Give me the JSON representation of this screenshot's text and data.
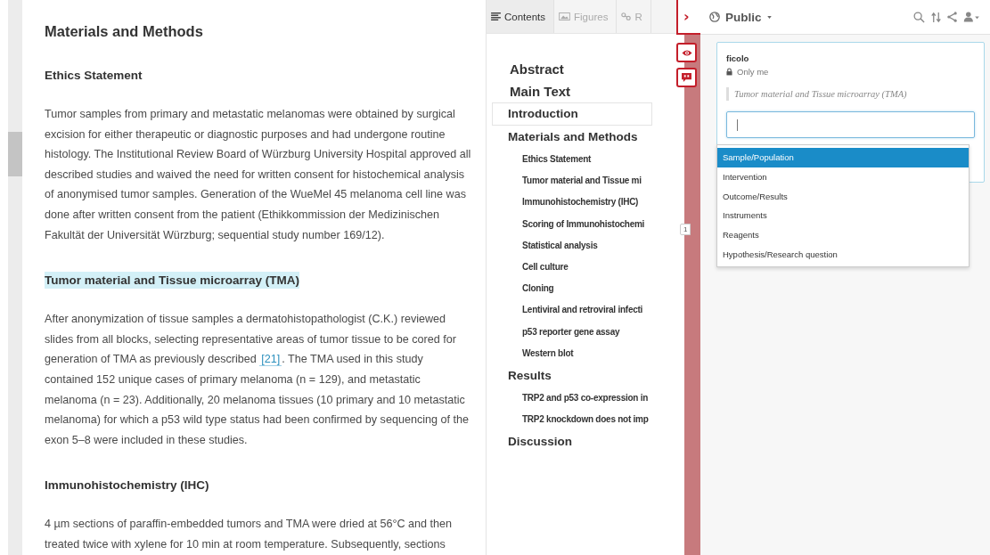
{
  "article": {
    "blocks": [
      {
        "kind": "h2",
        "text": "Materials and Methods",
        "highlighted": false
      },
      {
        "kind": "h3",
        "text": "Ethics Statement",
        "highlighted": false
      },
      {
        "kind": "p",
        "parts": [
          {
            "kind": "text",
            "text": "Tumor samples from primary and metastatic melanomas were obtained by surgical excision for either therapeutic or diagnostic purposes and had undergone routine histology. The Institutional Review Board of Würzburg University Hospital approved all described studies and waived the need for written consent for histochemical analysis of anonymised tumor samples. Generation of the WueMel 45 melanoma cell line was done after written consent from the patient (Ethikkommission der Medizinischen Fakultät der Universität Würzburg; sequential study number 169/12)."
          }
        ]
      },
      {
        "kind": "h3",
        "text": "Tumor material and Tissue microarray (TMA)",
        "highlighted": true
      },
      {
        "kind": "p",
        "parts": [
          {
            "kind": "text",
            "text": "After anonymization of tissue samples a dermatohistopathologist (C.K.) reviewed slides from all blocks, selecting representative areas of tumor tissue to be cored for generation of TMA as previously described "
          },
          {
            "kind": "citation",
            "text": "[21]"
          },
          {
            "kind": "text",
            "text": ". The TMA used in this study contained 152 unique cases of primary melanoma (n = 129), and metastatic melanoma (n = 23). Additionally, 20 melanoma tissues (10 primary and 10 metastatic melanoma) for which a p53 wild type status had been confirmed by sequencing of the exon 5–8 were included in these studies."
          }
        ]
      },
      {
        "kind": "h3",
        "text": "Immunohistochemistry (IHC)",
        "highlighted": false
      },
      {
        "kind": "p",
        "parts": [
          {
            "kind": "text",
            "text": "4 µm sections of paraffin-embedded tumors and TMA were dried at 56°C and then treated twice with xylene for 10 min at room temperature. Subsequently, sections"
          }
        ]
      }
    ]
  },
  "contents": {
    "tabs": [
      {
        "label": "Contents",
        "selected": true
      },
      {
        "label": "Figures",
        "selected": false
      },
      {
        "label": "R",
        "selected": false
      }
    ],
    "items": [
      {
        "label": "Abstract",
        "selected": false
      },
      {
        "label": "Main Text",
        "selected": false,
        "children": [
          {
            "label": "Introduction",
            "selected": true
          },
          {
            "label": "Materials and Methods",
            "selected": false,
            "children": [
              {
                "label": "Ethics Statement",
                "selected": false
              },
              {
                "label": "Tumor material and Tissue mi",
                "selected": false
              },
              {
                "label": "Immunohistochemistry (IHC)",
                "selected": false
              },
              {
                "label": "Scoring of Immunohistochemi",
                "selected": false
              },
              {
                "label": "Statistical analysis",
                "selected": false
              },
              {
                "label": "Cell culture",
                "selected": false
              },
              {
                "label": "Cloning",
                "selected": false
              },
              {
                "label": "Lentiviral and retroviral infecti",
                "selected": false
              },
              {
                "label": "p53 reporter gene assay",
                "selected": false
              },
              {
                "label": "Western blot",
                "selected": false
              }
            ]
          },
          {
            "label": "Results",
            "selected": false,
            "children": [
              {
                "label": "TRP2 and p53 co-expression in",
                "selected": false
              },
              {
                "label": "TRP2 knockdown does not imp",
                "selected": false
              }
            ]
          },
          {
            "label": "Discussion",
            "selected": false
          }
        ]
      }
    ]
  },
  "strip": {
    "toggle": "›",
    "badge": "1"
  },
  "sidebar": {
    "visibility": "Public",
    "annotation": {
      "user": "ficolo",
      "privacy": "Only me",
      "quote": "Tumor material and Tissue microarray (TMA)"
    },
    "suggestions": [
      {
        "label": "Sample/Population",
        "selected": true
      },
      {
        "label": "Intervention",
        "selected": false
      },
      {
        "label": "Outcome/Results",
        "selected": false
      },
      {
        "label": "Instruments",
        "selected": false
      },
      {
        "label": "Reagents",
        "selected": false
      },
      {
        "label": "Hypothesis/Research question",
        "selected": false
      }
    ]
  }
}
